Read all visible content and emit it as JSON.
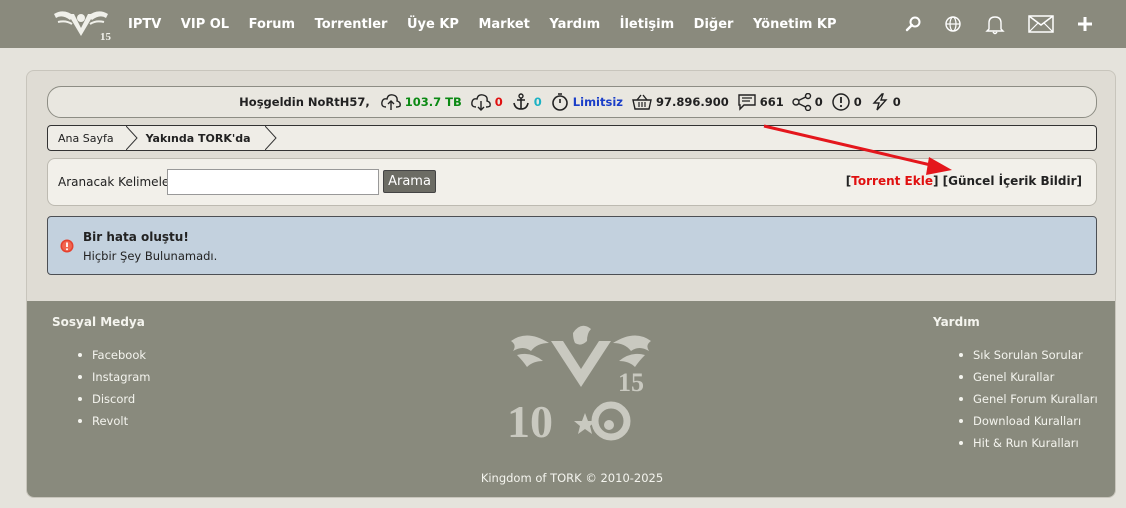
{
  "nav": {
    "items": [
      "IPTV",
      "VIP OL",
      "Forum",
      "Torrentler",
      "Üye KP",
      "Market",
      "Yardım",
      "İletişim",
      "Diğer",
      "Yönetim KP"
    ],
    "logo_badge": "15",
    "icons": [
      "search-icon",
      "globe-icon",
      "bell-icon",
      "mail-icon",
      "plus-icon"
    ]
  },
  "stats": {
    "greeting": "Hoşgeldin NoRtH57,",
    "upload": "103.7 TB",
    "download": "0",
    "seeding": "0",
    "ratio": "Limitsiz",
    "bonus": "97.896.900",
    "comments": "661",
    "shares": "0",
    "warnings": "0",
    "hits": "0",
    "colors": {
      "upload": "#0c8a14",
      "download": "#e01010",
      "seeding": "#1cb2c4",
      "ratio": "#1a3ec8"
    }
  },
  "breadcrumb": {
    "home": "Ana Sayfa",
    "current": "Yakında TORK'da"
  },
  "search": {
    "label": "Aranacak Kelimeler:",
    "value": "",
    "button": "Arama",
    "bracket_open": "[",
    "bracket_close": "]",
    "add_torrent": "Torrent Ekle",
    "report": "Güncel İçerik Bildir"
  },
  "alert": {
    "title": "Bir hata oluştu!",
    "message": "Hiçbir Şey Bulunamadı."
  },
  "footer": {
    "social_title": "Sosyal Medya",
    "social_links": [
      "Facebook",
      "Instagram",
      "Discord",
      "Revolt"
    ],
    "help_title": "Yardım",
    "help_links": [
      "Sık Sorulan Sorular",
      "Genel Kurallar",
      "Genel Forum Kuralları",
      "Download Kuralları",
      "Hit & Run Kuralları"
    ],
    "logo_badge": "15",
    "logo_number_left": "10",
    "copyright": "Kingdom of TORK © 2010-2025"
  }
}
